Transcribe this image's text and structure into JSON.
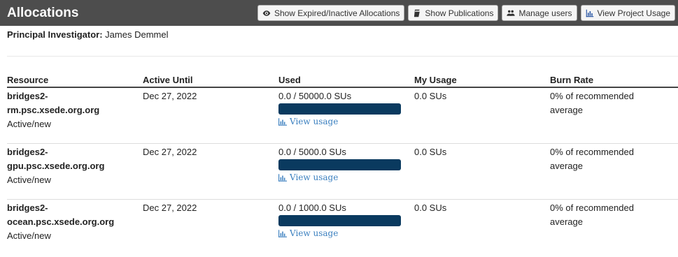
{
  "header": {
    "title": "Allocations",
    "buttons": [
      {
        "label": "Show Expired/Inactive Allocations",
        "icon": "eye-icon"
      },
      {
        "label": "Show Publications",
        "icon": "book-icon"
      },
      {
        "label": "Manage users",
        "icon": "users-icon"
      },
      {
        "label": "View Project Usage",
        "icon": "bar-chart-icon"
      }
    ]
  },
  "pi": {
    "label": "Principal Investigator:",
    "name": "James Demmel"
  },
  "table": {
    "columns": [
      "Resource",
      "Active Until",
      "Used",
      "My Usage",
      "Burn Rate"
    ],
    "rows": [
      {
        "resource_line1": "bridges2-",
        "resource_line2": "rm.psc.xsede.org.org",
        "status": "Active/new",
        "active_until": "Dec 27, 2022",
        "used": "0.0 / 50000.0 SUs",
        "used_fraction": 0.0,
        "view_usage": "View usage",
        "my_usage": "0.0 SUs",
        "burn_rate_line1": "0% of recommended",
        "burn_rate_line2": "average"
      },
      {
        "resource_line1": "bridges2-",
        "resource_line2": "gpu.psc.xsede.org.org",
        "status": "Active/new",
        "active_until": "Dec 27, 2022",
        "used": "0.0 / 5000.0 SUs",
        "used_fraction": 0.0,
        "view_usage": "View usage",
        "my_usage": "0.0 SUs",
        "burn_rate_line1": "0% of recommended",
        "burn_rate_line2": "average"
      },
      {
        "resource_line1": "bridges2-",
        "resource_line2": "ocean.psc.xsede.org.org",
        "status": "Active/new",
        "active_until": "Dec 27, 2022",
        "used": "0.0 / 1000.0 SUs",
        "used_fraction": 0.0,
        "view_usage": "View usage",
        "my_usage": "0.0 SUs",
        "burn_rate_line1": "0% of recommended",
        "burn_rate_line2": "average"
      }
    ]
  },
  "colors": {
    "header_bg": "#4d4d4d",
    "progress_bar": "#0a3a5f",
    "link": "#3a7fbf"
  }
}
